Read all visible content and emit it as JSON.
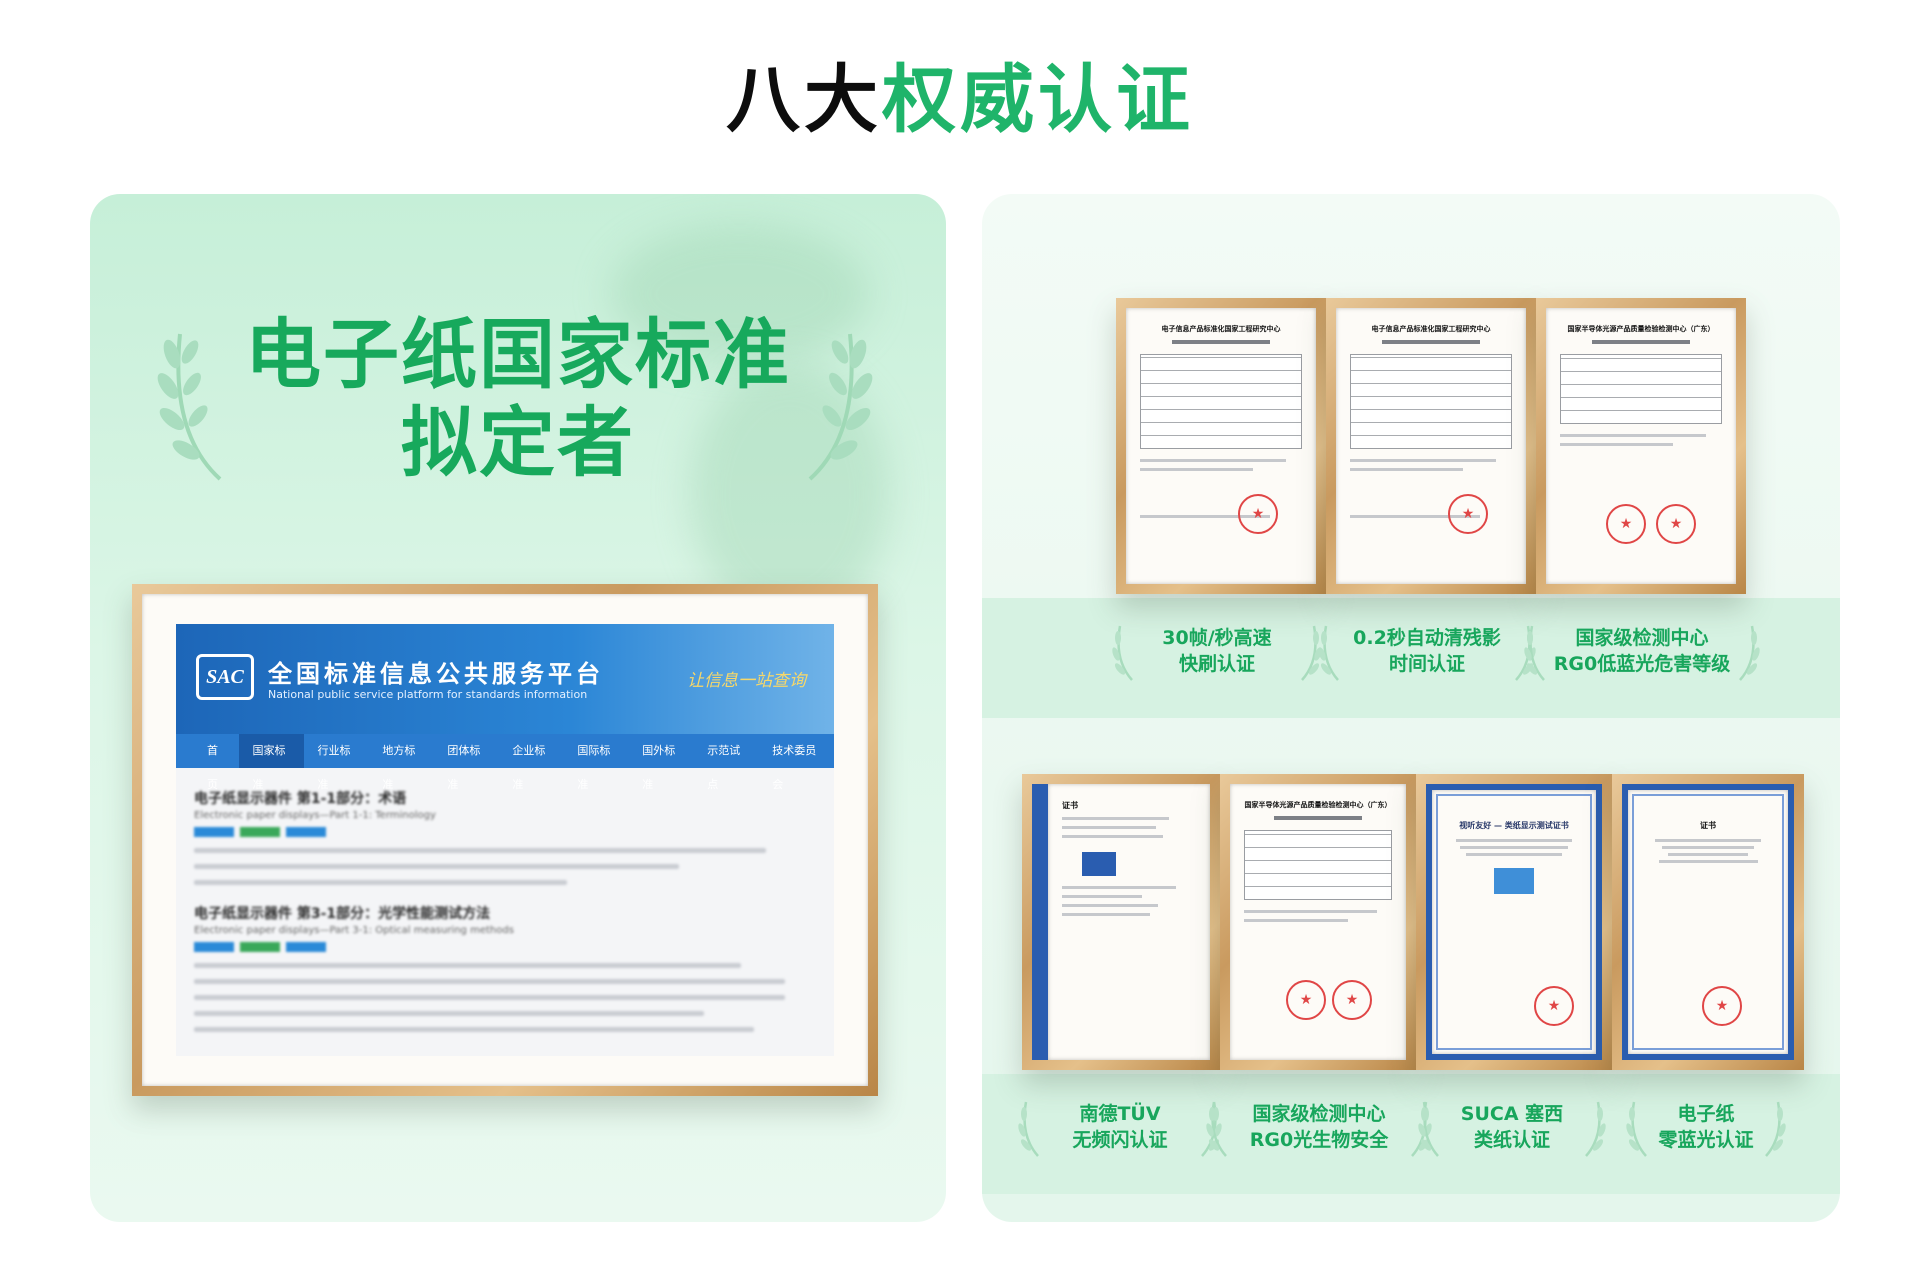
{
  "title": {
    "part1": "八大",
    "part2": "权威认证"
  },
  "left_panel": {
    "headline_line1": "电子纸国家标准",
    "headline_line2": "拟定者",
    "screenshot": {
      "logo": "SAC",
      "site_title": "全国标准信息公共服务平台",
      "site_subtitle": "National public service platform  for standards information",
      "slogan": "让信息一站查询",
      "nav": [
        "首页",
        "国家标准",
        "行业标准",
        "地方标准",
        "团体标准",
        "企业标准",
        "国际标准",
        "国外标准",
        "示范试点",
        "技术委员会"
      ],
      "std1_title": "电子纸显示器件 第1-1部分：术语",
      "std1_en": "Electronic paper displays—Part 1-1: Terminology",
      "std2_title": "电子纸显示器件 第3-1部分：光学性能测试方法",
      "std2_en": "Electronic paper displays—Part 3-1: Optical measuring methods"
    }
  },
  "right_panel": {
    "row1": [
      {
        "line1": "30帧/秒高速",
        "line2": "快刷认证"
      },
      {
        "line1": "0.2秒自动清残影",
        "line2": "时间认证"
      },
      {
        "line1": "国家级检测中心",
        "line2": "RG0低蓝光危害等级"
      }
    ],
    "row2": [
      {
        "line1": "南德TÜV",
        "line2": "无频闪认证"
      },
      {
        "line1": "国家级检测中心",
        "line2": "RG0光生物安全"
      },
      {
        "line1": "SUCA 塞西",
        "line2": "类纸认证"
      },
      {
        "line1": "电子纸",
        "line2": "零蓝光认证"
      }
    ],
    "cert_titles": {
      "c1": "电子信息产品标准化国家工程研究中心",
      "c2": "电子信息产品标准化国家工程研究中心",
      "c3": "国家半导体光源产品质量检验检测中心（广东）",
      "c4": "证书",
      "c5": "国家半导体光源产品质量检验检测中心（广东）",
      "c6": "视听友好 — 类纸显示测试证书",
      "c7": "证书"
    },
    "colors": {
      "accent_green": "#1fb46a",
      "frame_wood": "#c99a5f"
    }
  }
}
